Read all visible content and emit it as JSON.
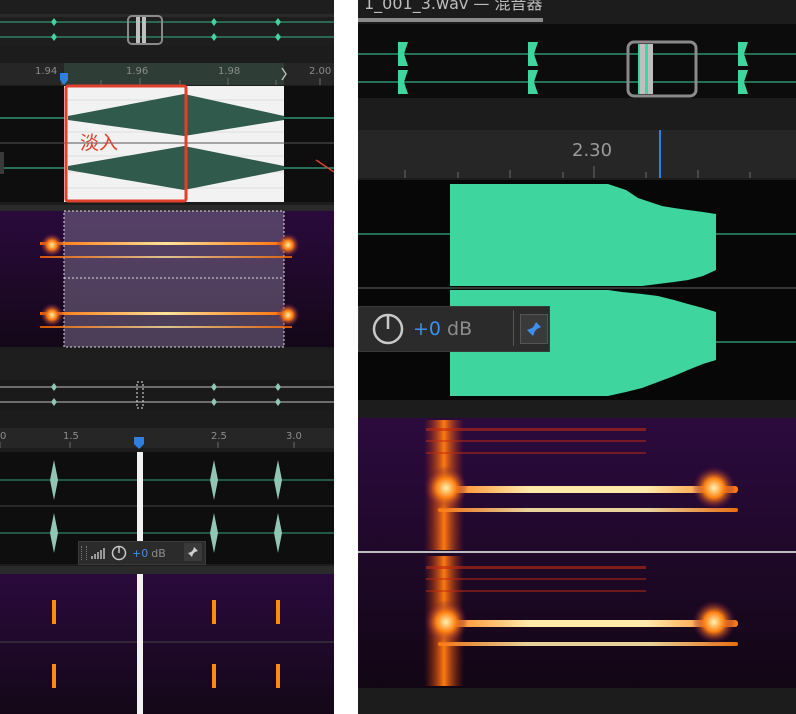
{
  "left_panel": {
    "top_ruler": {
      "ticks": [
        "1.94",
        "1.96",
        "1.98",
        "2.00"
      ]
    },
    "fade_in_label": "淡入",
    "lower_ruler": {
      "ticks": [
        "0",
        "1.5",
        "2.5",
        "3.0"
      ]
    },
    "gain_widget": {
      "value": "+0",
      "unit": "dB"
    }
  },
  "right_panel": {
    "title_fragment": "1_001_3.wav  —  混音器",
    "ruler": {
      "ticks": [
        "2.30"
      ]
    },
    "gain_widget": {
      "value": "+0",
      "unit": "dB"
    }
  },
  "colors": {
    "waveform_teal": "#3fd59f",
    "waveform_dark": "#2f5a4c",
    "selection_blue": "#2f7fe0",
    "fade_highlight": "#e0402c",
    "gain_value_blue": "#3c8ff0"
  }
}
